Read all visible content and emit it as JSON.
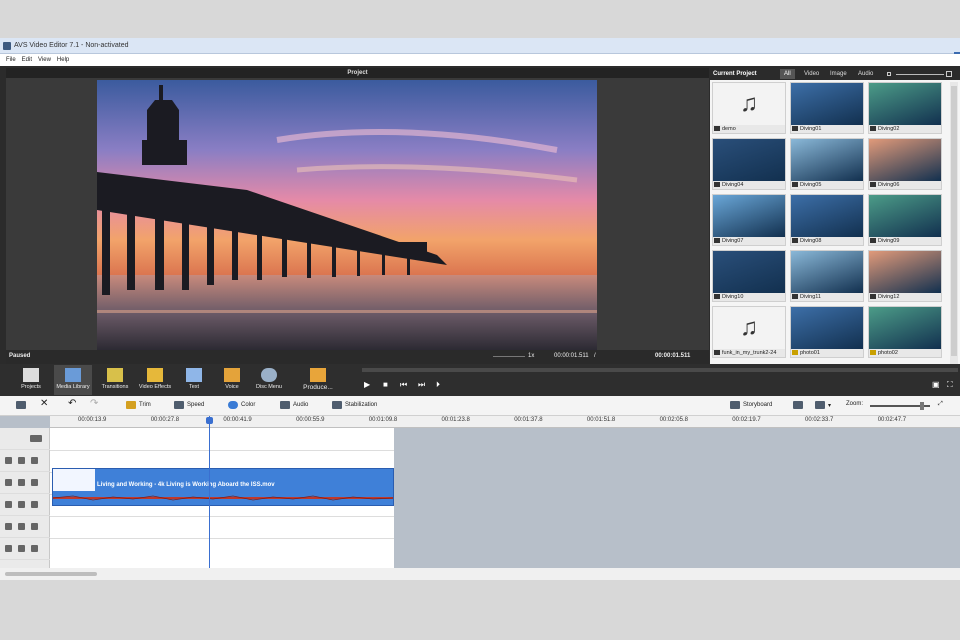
{
  "window": {
    "title": "AVS Video Editor 7.1 - Non-activated"
  },
  "menu": [
    "File",
    "Edit",
    "View",
    "Help"
  ],
  "preview": {
    "title": "Project",
    "status": "Paused",
    "speed": "1x",
    "current_time": "00:00:01.511",
    "separator": "/",
    "total_time": "00:00:01.511"
  },
  "media_panel": {
    "title": "Current Project",
    "filters": [
      "All",
      "Video",
      "Image",
      "Audio"
    ],
    "active_filter": "All",
    "items": [
      {
        "name": "demo",
        "kind": "audio"
      },
      {
        "name": "Diving01",
        "kind": "video"
      },
      {
        "name": "Diving02",
        "kind": "video"
      },
      {
        "name": "Diving04",
        "kind": "video"
      },
      {
        "name": "Diving05",
        "kind": "video"
      },
      {
        "name": "Diving06",
        "kind": "video"
      },
      {
        "name": "Diving07",
        "kind": "video"
      },
      {
        "name": "Diving08",
        "kind": "video"
      },
      {
        "name": "Diving09",
        "kind": "video"
      },
      {
        "name": "Diving10",
        "kind": "video"
      },
      {
        "name": "Diving11",
        "kind": "video"
      },
      {
        "name": "Diving12",
        "kind": "video"
      },
      {
        "name": "funk_in_my_trunk2-24",
        "kind": "audio"
      },
      {
        "name": "photo01",
        "kind": "photo"
      },
      {
        "name": "photo02",
        "kind": "photo"
      }
    ]
  },
  "main_toolbar": {
    "buttons": [
      "Projects",
      "Media Library",
      "Transitions",
      "Video Effects",
      "Text",
      "Voice",
      "Disc Menu",
      "Produce..."
    ],
    "active": "Media Library"
  },
  "edit_toolbar": {
    "trim": "Trim",
    "speed": "Speed",
    "color": "Color",
    "audio": "Audio",
    "stabilization": "Stabilization",
    "storyboard": "Storyboard",
    "zoom_label": "Zoom:"
  },
  "timeline": {
    "ticks": [
      "00:00:13.9",
      "00:00:27.8",
      "00:00:41.9",
      "00:00:55.9",
      "00:01:09.8",
      "00:01:23.8",
      "00:01:37.8",
      "00:01:51.8",
      "00:02:05.8",
      "00:02:19.7",
      "00:02:33.7",
      "00:02:47.7"
    ],
    "clip_title": "Living and Working - 4k Living is Working Aboard the ISS.mov"
  },
  "colors": {
    "accent": "#3f80d8",
    "dark": "#2b2b2b",
    "waveform": "#c0392b"
  }
}
